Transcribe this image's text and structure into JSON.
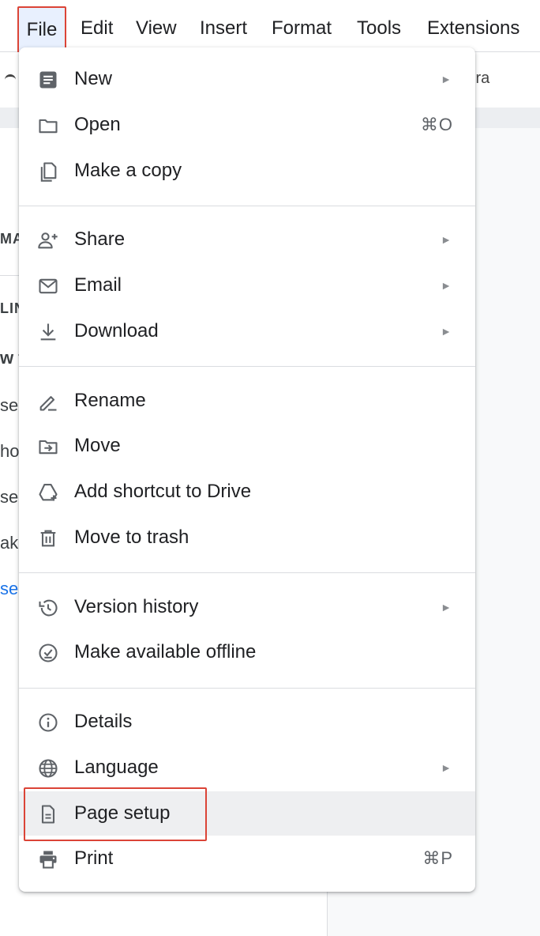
{
  "menubar": {
    "items": [
      "File",
      "Edit",
      "View",
      "Insert",
      "Format",
      "Tools",
      "Extensions"
    ]
  },
  "toolbar": {
    "tail_text": "ira"
  },
  "document": {
    "lines": [
      "MA",
      "LIN",
      "w t",
      "se",
      "ho",
      "se",
      "ak",
      "se"
    ],
    "link_color": "#1a73e8"
  },
  "file_menu": {
    "items": [
      {
        "label": "New",
        "icon": "document-icon",
        "submenu": true
      },
      {
        "label": "Open",
        "icon": "folder-icon",
        "shortcut": "⌘O"
      },
      {
        "label": "Make a copy",
        "icon": "copy-icon"
      },
      {
        "label": "Share",
        "icon": "add-person-icon",
        "submenu": true
      },
      {
        "label": "Email",
        "icon": "email-icon",
        "submenu": true
      },
      {
        "label": "Download",
        "icon": "download-icon",
        "submenu": true
      },
      {
        "label": "Rename",
        "icon": "rename-icon"
      },
      {
        "label": "Move",
        "icon": "move-folder-icon"
      },
      {
        "label": "Add shortcut to Drive",
        "icon": "drive-shortcut-icon"
      },
      {
        "label": "Move to trash",
        "icon": "trash-icon"
      },
      {
        "label": "Version history",
        "icon": "history-icon",
        "submenu": true
      },
      {
        "label": "Make available offline",
        "icon": "offline-check-icon"
      },
      {
        "label": "Details",
        "icon": "info-icon"
      },
      {
        "label": "Language",
        "icon": "globe-icon",
        "submenu": true
      },
      {
        "label": "Page setup",
        "icon": "page-icon",
        "highlighted": true
      },
      {
        "label": "Print",
        "icon": "printer-icon",
        "shortcut": "⌘P"
      }
    ],
    "submenu_glyph": "►"
  },
  "colors": {
    "highlight_box": "#db4437",
    "active_menu_bg": "#e8f0fe",
    "hover_bg": "#eeeff1"
  }
}
